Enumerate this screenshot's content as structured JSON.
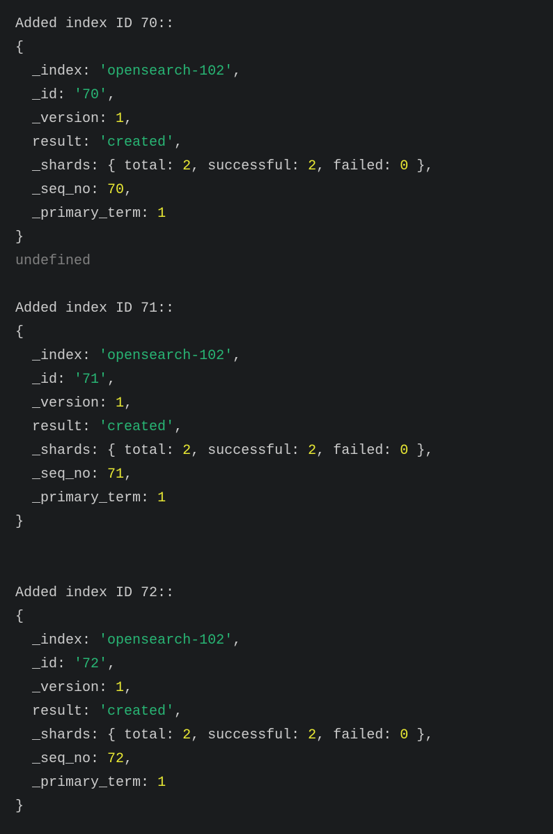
{
  "console": {
    "entries": [
      {
        "header": "Added index ID 70::",
        "index": "'opensearch-102'",
        "id": "'70'",
        "version": "1",
        "result": "'created'",
        "shards_total": "2",
        "shards_successful": "2",
        "shards_failed": "0",
        "seq_no": "70",
        "primary_term": "1",
        "trailer": "undefined"
      },
      {
        "header": "Added index ID 71::",
        "index": "'opensearch-102'",
        "id": "'71'",
        "version": "1",
        "result": "'created'",
        "shards_total": "2",
        "shards_successful": "2",
        "shards_failed": "0",
        "seq_no": "71",
        "primary_term": "1",
        "trailer": ""
      },
      {
        "header": "Added index ID 72::",
        "index": "'opensearch-102'",
        "id": "'72'",
        "version": "1",
        "result": "'created'",
        "shards_total": "2",
        "shards_successful": "2",
        "shards_failed": "0",
        "seq_no": "72",
        "primary_term": "1",
        "trailer": ""
      }
    ],
    "labels": {
      "index": "_index",
      "id": "_id",
      "version": "_version",
      "result": "result",
      "shards": "_shards",
      "total": "total",
      "successful": "successful",
      "failed": "failed",
      "seq_no": "_seq_no",
      "primary_term": "_primary_term"
    }
  }
}
